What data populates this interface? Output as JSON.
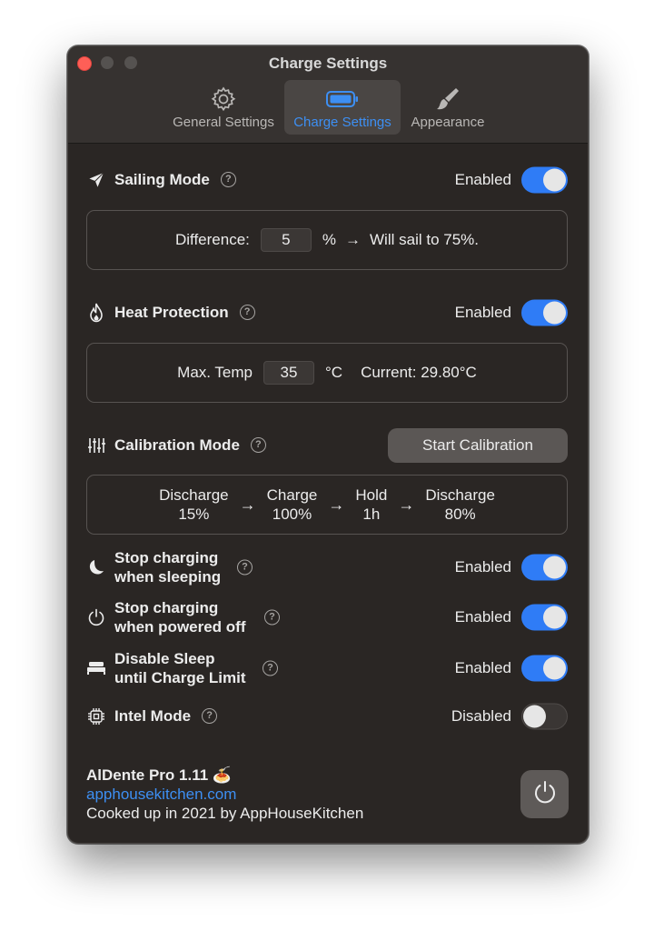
{
  "window": {
    "title": "Charge Settings"
  },
  "tabs": [
    {
      "label": "General Settings",
      "icon": "gear-icon"
    },
    {
      "label": "Charge Settings",
      "icon": "battery-icon",
      "active": true
    },
    {
      "label": "Appearance",
      "icon": "paintbrush-icon"
    }
  ],
  "sailing": {
    "title": "Sailing Mode",
    "status": "Enabled",
    "enabled": true,
    "difference_label": "Difference:",
    "difference_value": "5",
    "unit": "%",
    "arrow": "→",
    "result": "Will sail to 75%."
  },
  "heat": {
    "title": "Heat Protection",
    "status": "Enabled",
    "enabled": true,
    "max_label": "Max. Temp",
    "max_value": "35",
    "unit": "°C",
    "current": "Current: 29.80°C"
  },
  "calibration": {
    "title": "Calibration Mode",
    "button_label": "Start Calibration",
    "arrow": "→",
    "steps": [
      {
        "name": "Discharge",
        "value": "15%"
      },
      {
        "name": "Charge",
        "value": "100%"
      },
      {
        "name": "Hold",
        "value": "1h"
      },
      {
        "name": "Discharge",
        "value": "80%"
      }
    ]
  },
  "stop_sleeping": {
    "title_line1": "Stop charging",
    "title_line2": "when sleeping",
    "status": "Enabled",
    "enabled": true
  },
  "stop_powered_off": {
    "title_line1": "Stop charging",
    "title_line2": "when powered off",
    "status": "Enabled",
    "enabled": true
  },
  "disable_sleep": {
    "title_line1": "Disable Sleep",
    "title_line2": "until Charge Limit",
    "status": "Enabled",
    "enabled": true
  },
  "intel": {
    "title": "Intel Mode",
    "status": "Disabled",
    "enabled": false
  },
  "help_glyph": "?",
  "footer": {
    "app_name": "AlDente Pro 1.11",
    "app_emoji": "🍝",
    "link": "apphousekitchen.com",
    "credit": "Cooked up in 2021 by AppHouseKitchen"
  },
  "colors": {
    "accent": "#2f7cf6",
    "link": "#3d8ff3",
    "background": "#2a2624"
  }
}
